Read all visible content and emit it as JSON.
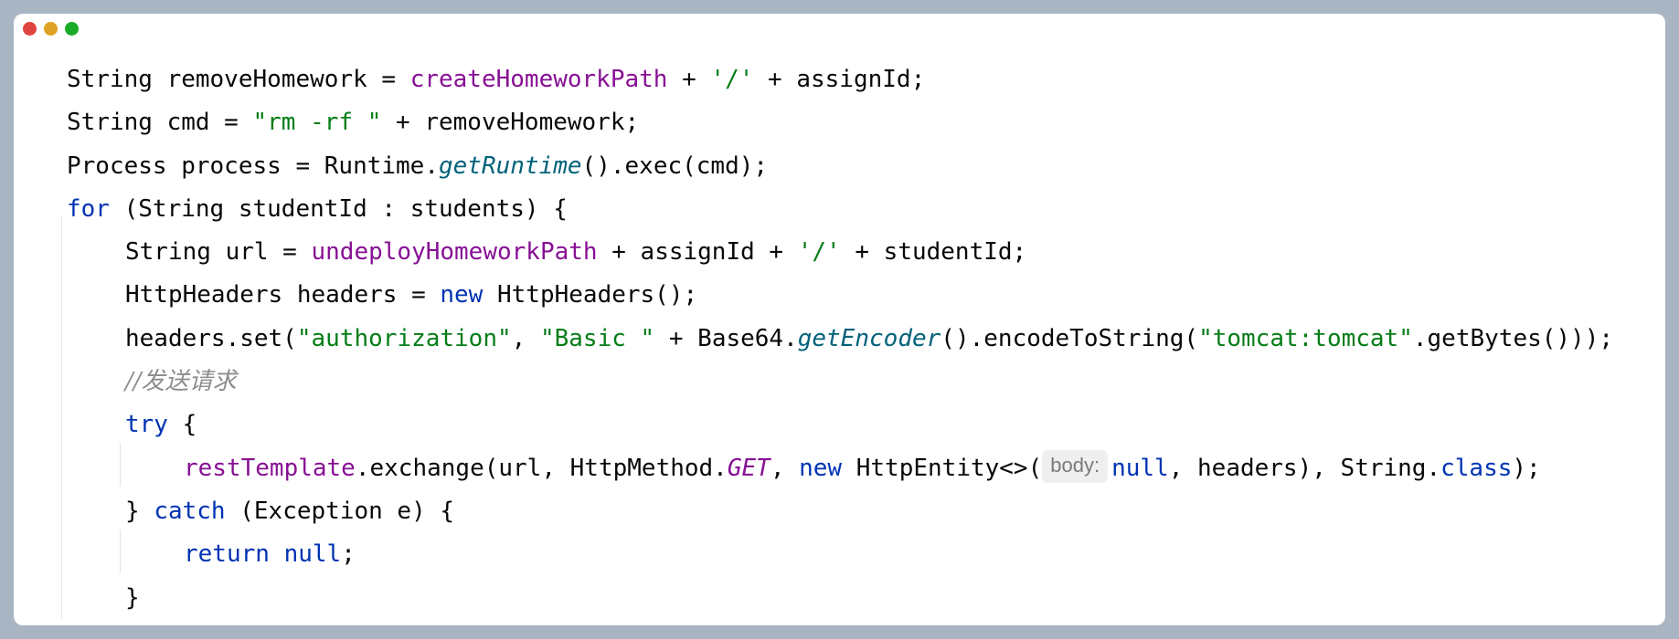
{
  "window": {
    "controls": [
      "close",
      "minimize",
      "zoom"
    ],
    "colors": {
      "background": "#a9b5c3",
      "editor": "#ffffff",
      "close": "#e0443e",
      "minimize": "#dea123",
      "zoom": "#1aab29",
      "keyword": "#0033b3",
      "field": "#871094",
      "string": "#067d17",
      "static_method": "#00627a",
      "comment": "#8c8c8c",
      "hint_bg": "#efefef"
    }
  },
  "code": {
    "l1": {
      "t1": "String removeHomework = ",
      "field": "createHomeworkPath",
      "t2": " + ",
      "str": "'/'",
      "t3": " + assignId;"
    },
    "l2": {
      "t1": "String cmd = ",
      "str": "\"rm -rf \"",
      "t2": " + removeHomework;"
    },
    "l3": {
      "t1": "Process process = Runtime.",
      "method": "getRuntime",
      "t2": "().exec(cmd);"
    },
    "l4": {
      "kw": "for",
      "t1": " (String studentId : students) {"
    },
    "l5": {
      "t1": "String url = ",
      "field": "undeployHomeworkPath",
      "t2": " + assignId + ",
      "str": "'/'",
      "t3": " + studentId;"
    },
    "l6": {
      "t1": "HttpHeaders headers = ",
      "kw": "new",
      "t2": " HttpHeaders();"
    },
    "l7": {
      "t1": "headers.set(",
      "str1": "\"authorization\"",
      "t2": ", ",
      "str2": "\"Basic \"",
      "t3": " + Base64.",
      "method": "getEncoder",
      "t4": "().encodeToString(",
      "str3": "\"tomcat:tomcat\"",
      "t5": ".getBytes()));"
    },
    "l8": {
      "comment": "//发送请求"
    },
    "l9": {
      "kw": "try",
      "t1": " {"
    },
    "l10": {
      "field": "restTemplate",
      "t1": ".exchange(url, HttpMethod.",
      "sfield": "GET",
      "t2": ", ",
      "kw1": "new",
      "t3": " HttpEntity<>(",
      "hint": "body:",
      "kw2": "null",
      "t4": ", headers), String.",
      "kw3": "class",
      "t5": ");"
    },
    "l11": {
      "t1": "} ",
      "kw": "catch",
      "t2": " (Exception e) {"
    },
    "l12": {
      "kw1": "return",
      "t1": " ",
      "kw2": "null",
      "t2": ";"
    },
    "l13": {
      "t1": "}"
    }
  }
}
